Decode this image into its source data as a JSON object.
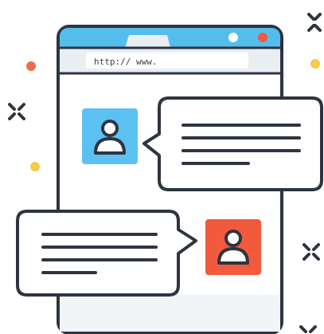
{
  "browser": {
    "url_text": "http:// www.",
    "accent_color": "#54BDEB"
  },
  "chat": {
    "incoming": {
      "avatar": "user-icon",
      "avatar_color": "#5BC0F2",
      "lines": 4
    },
    "outgoing": {
      "avatar": "user-icon",
      "avatar_color": "#F15A3D",
      "lines": 4
    }
  },
  "decor": {
    "dot_colors": [
      "#F26A4B",
      "#F7C948"
    ],
    "sparkle_color": "#2E3440"
  }
}
